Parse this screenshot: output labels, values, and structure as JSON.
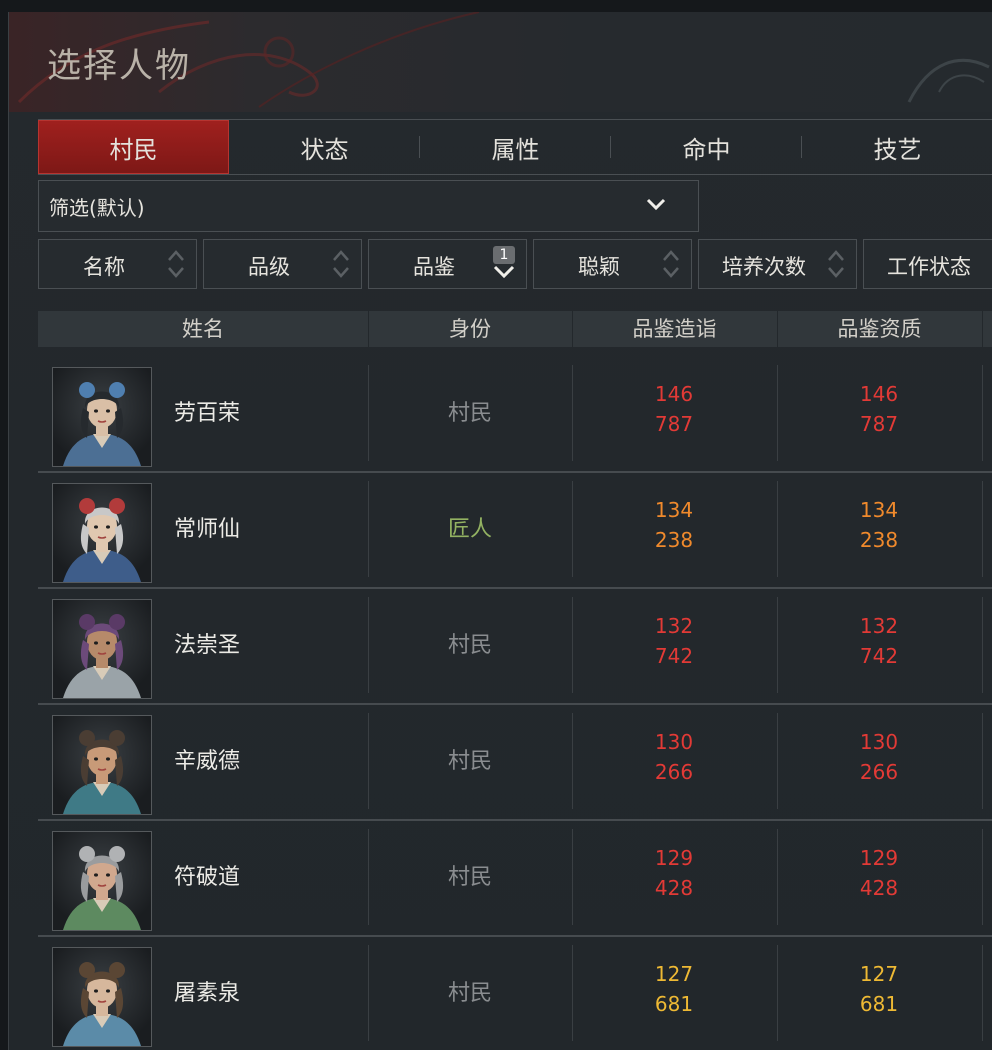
{
  "window": {
    "title": "选择人物"
  },
  "tabs": [
    {
      "label": "村民",
      "active": true
    },
    {
      "label": "状态",
      "active": false
    },
    {
      "label": "属性",
      "active": false
    },
    {
      "label": "命中",
      "active": false
    },
    {
      "label": "技艺",
      "active": false
    }
  ],
  "filter": {
    "label": "筛选(默认)",
    "icon": "chevron-down-icon"
  },
  "sort_buttons": [
    {
      "label": "名称",
      "icon": "sort-updown-icon"
    },
    {
      "label": "品级",
      "icon": "sort-updown-icon"
    },
    {
      "label": "品鉴",
      "badge": "1",
      "icon": "sort-desc-icon"
    },
    {
      "label": "聪颖",
      "icon": "sort-updown-icon"
    },
    {
      "label": "培养次数",
      "icon": "sort-updown-icon"
    },
    {
      "label": "工作状态",
      "icon": "sort-updown-icon"
    }
  ],
  "table": {
    "headers": [
      "姓名",
      "身份",
      "品鉴造诣",
      "品鉴资质"
    ],
    "rows": [
      {
        "name": "劳百荣",
        "role": "村民",
        "skill": [
          "146",
          "787"
        ],
        "aptitude": [
          "146",
          "787"
        ],
        "tier": "red"
      },
      {
        "name": "常师仙",
        "role": "匠人",
        "skill": [
          "134",
          "238"
        ],
        "aptitude": [
          "134",
          "238"
        ],
        "tier": "orange"
      },
      {
        "name": "法崇圣",
        "role": "村民",
        "skill": [
          "132",
          "742"
        ],
        "aptitude": [
          "132",
          "742"
        ],
        "tier": "red"
      },
      {
        "name": "辛威德",
        "role": "村民",
        "skill": [
          "130",
          "266"
        ],
        "aptitude": [
          "130",
          "266"
        ],
        "tier": "red"
      },
      {
        "name": "符破道",
        "role": "村民",
        "skill": [
          "129",
          "428"
        ],
        "aptitude": [
          "129",
          "428"
        ],
        "tier": "red"
      },
      {
        "name": "屠素泉",
        "role": "村民",
        "skill": [
          "127",
          "681"
        ],
        "aptitude": [
          "127",
          "681"
        ],
        "tier": "yellow"
      }
    ]
  },
  "colors": {
    "red": "#e23a36",
    "orange": "#f08a2c",
    "yellow": "#eeb934",
    "role_villager": "#8a8d90",
    "role_artisan": "#93b262",
    "tab_active": "#9a1f1d"
  },
  "portraits": [
    {
      "hair": "#262a2e",
      "accessory": "#4f7fb0",
      "skin": "#d9bfa6",
      "robe": "#4c6f94"
    },
    {
      "hair": "#c8c8c8",
      "accessory": "#b23b3b",
      "skin": "#e0c8b0",
      "robe": "#3e5d8a"
    },
    {
      "hair": "#6c4a7a",
      "accessory": "#5a3a66",
      "skin": "#b68a6a",
      "robe": "#9aa3a8"
    },
    {
      "hair": "#4a3d33",
      "accessory": "#4a3d33",
      "skin": "#c89a78",
      "robe": "#3f7a86"
    },
    {
      "hair": "#9a9c9e",
      "accessory": "#b0b2b4",
      "skin": "#d0a88e",
      "robe": "#5d8a60"
    },
    {
      "hair": "#5a4634",
      "accessory": "#5a4634",
      "skin": "#d6b79c",
      "robe": "#5b8ba8"
    }
  ]
}
